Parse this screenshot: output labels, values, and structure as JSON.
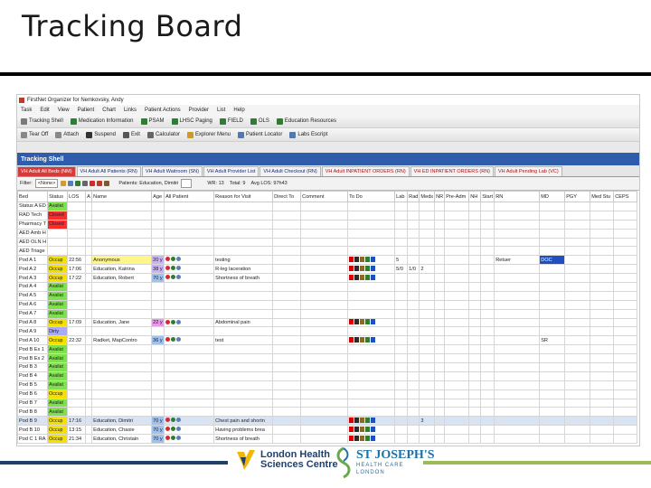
{
  "slide": {
    "title": "Tracking Board"
  },
  "window": {
    "title": "FirstNet Organizer for Nemkovsky, Andy"
  },
  "menu": [
    "Task",
    "Edit",
    "View",
    "Patient",
    "Chart",
    "Links",
    "Patient Actions",
    "Provider",
    "List",
    "Help"
  ],
  "toolbar1": [
    {
      "label": "Tracking Shell",
      "icon": "grid-icon",
      "color": "#7a7a7a"
    },
    {
      "label": "Medication Information",
      "icon": "info-icon",
      "color": "#2e7d32"
    },
    {
      "label": "PSAM",
      "icon": "link-icon",
      "color": "#2e7d32"
    },
    {
      "label": "LHSC Paging",
      "icon": "link-icon",
      "color": "#2e7d32"
    },
    {
      "label": "FIELD",
      "icon": "link-icon",
      "color": "#2e7d32"
    },
    {
      "label": "OLS",
      "icon": "link-icon",
      "color": "#2e7d32"
    },
    {
      "label": "Education Resources",
      "icon": "link-icon",
      "color": "#2e7d32"
    }
  ],
  "toolbar2": [
    {
      "label": "Tear Off",
      "icon": "tearoff-icon",
      "color": "#888888"
    },
    {
      "label": "Attach",
      "icon": "attach-icon",
      "color": "#888888"
    },
    {
      "label": "Suspend",
      "icon": "suspend-icon",
      "color": "#333333"
    },
    {
      "label": "Exit",
      "icon": "exit-icon",
      "color": "#555555"
    },
    {
      "label": "Calculator",
      "icon": "calculator-icon",
      "color": "#666666"
    },
    {
      "label": "Explorer Menu",
      "icon": "explorer-icon",
      "color": "#c99a2e"
    },
    {
      "label": "Patient Locator",
      "icon": "locator-icon",
      "color": "#5577aa"
    },
    {
      "label": "Labs Escript",
      "icon": "labs-icon",
      "color": "#5577aa"
    }
  ],
  "tracking_header": "Tracking Shell",
  "tabs": [
    {
      "label": "VH Adult All Beds (NM)",
      "active": true
    },
    {
      "label": "VH Adult All Patients (RN)",
      "active": false
    },
    {
      "label": "VH Adult Waitroom (SN)",
      "active": false
    },
    {
      "label": "VH Adult Provider List",
      "active": false
    },
    {
      "label": "VH Adult Checkout (RN)",
      "active": false
    },
    {
      "label": "VH Adult INPATIENT ORDERS (RN)",
      "active": false
    },
    {
      "label": "VH ED INPATIENT ORDERS (RN)",
      "active": false
    },
    {
      "label": "VH Adult Pending Lab (VC)",
      "active": false
    }
  ],
  "filter": {
    "filter_label": "Filter:",
    "filter_value": "<None>",
    "patients_label": "Patients: Education, Dimitri",
    "wr_label": "WR: 13",
    "total_label": "Total: 9",
    "avg_label": "Avg LOS: 97h43"
  },
  "columns": [
    "Bed",
    "Status",
    "LOS",
    "A",
    "Name",
    "Age",
    "All Patient",
    "Reason for Visit",
    "Direct To",
    "Comment",
    "To Do",
    "Lab",
    "Rad",
    "Meds",
    "NR",
    "Pre-Adm",
    "NH",
    "Start",
    "RN",
    "MD",
    "PGY",
    "Med Stu",
    "CEPS"
  ],
  "rows": [
    {
      "bed": "Status A ED",
      "status": "Availat",
      "status_color": "#7ee04c",
      "los": "",
      "name": "",
      "age": "",
      "age_color": "",
      "reason": "",
      "todo": "",
      "lab": "",
      "rad": "",
      "meds": "",
      "nr": "",
      "rn": "",
      "md": "",
      "md_color": "",
      "selected": false
    },
    {
      "bed": "RAD Tech",
      "status": "Closed",
      "status_color": "#ff2a2a",
      "los": "",
      "name": "",
      "age": "",
      "age_color": "",
      "reason": "",
      "todo": "",
      "lab": "",
      "rad": "",
      "meds": "",
      "nr": "",
      "rn": "",
      "md": "",
      "md_color": "",
      "selected": false
    },
    {
      "bed": "Pharmacy T",
      "status": "Closed",
      "status_color": "#ff2a2a",
      "los": "",
      "name": "",
      "age": "",
      "age_color": "",
      "reason": "",
      "todo": "",
      "lab": "",
      "rad": "",
      "meds": "",
      "nr": "",
      "rn": "",
      "md": "",
      "md_color": "",
      "selected": false
    },
    {
      "bed": "AED Amb H",
      "status": "",
      "status_color": "",
      "los": "",
      "name": "",
      "age": "",
      "age_color": "",
      "reason": "",
      "todo": "",
      "lab": "",
      "rad": "",
      "meds": "",
      "nr": "",
      "rn": "",
      "md": "",
      "md_color": "",
      "selected": false
    },
    {
      "bed": "AED OLN H",
      "status": "",
      "status_color": "",
      "los": "",
      "name": "",
      "age": "",
      "age_color": "",
      "reason": "",
      "todo": "",
      "lab": "",
      "rad": "",
      "meds": "",
      "nr": "",
      "rn": "",
      "md": "",
      "md_color": "",
      "selected": false
    },
    {
      "bed": "AED Triage",
      "status": "",
      "status_color": "",
      "los": "",
      "name": "",
      "age": "",
      "age_color": "",
      "reason": "",
      "todo": "",
      "lab": "",
      "rad": "",
      "meds": "",
      "nr": "",
      "rn": "",
      "md": "",
      "md_color": "",
      "selected": false
    },
    {
      "bed": "Pod A 1",
      "status": "Occup",
      "status_color": "#f5e000",
      "los": "22:56",
      "name": "Anonymous",
      "name_color": "#fff68a",
      "age": "20 y",
      "age_color": "#c9b3f2",
      "reason": "testing",
      "todo": "icons",
      "lab": "5",
      "rad": "",
      "meds": "",
      "nr": "",
      "rn": "Retuer",
      "md": "DOC",
      "md_color": "#1f4fc0",
      "selected": false
    },
    {
      "bed": "Pod A 2",
      "status": "Occup",
      "status_color": "#f5e000",
      "los": "17:06",
      "name": "Education, Katrina",
      "age": "38 y",
      "age_color": "#c9b3f2",
      "reason": "R-leg laceration",
      "todo": "icons",
      "lab": "5/0",
      "rad": "1/0",
      "meds": "2",
      "nr": "",
      "rn": "",
      "md": "",
      "md_color": "",
      "selected": false
    },
    {
      "bed": "Pod A 3",
      "status": "Occup",
      "status_color": "#f5e000",
      "los": "17:22",
      "name": "Education, Robert",
      "age": "70 y",
      "age_color": "#9fc1f0",
      "reason": "Shortness of breath",
      "todo": "icons",
      "lab": "",
      "rad": "",
      "meds": "",
      "nr": "",
      "rn": "",
      "md": "",
      "md_color": "",
      "selected": false
    },
    {
      "bed": "Pod A 4",
      "status": "Availat",
      "status_color": "#7ee04c",
      "los": "",
      "name": "",
      "age": "",
      "age_color": "",
      "reason": "",
      "todo": "",
      "lab": "",
      "rad": "",
      "meds": "",
      "nr": "",
      "rn": "",
      "md": "",
      "md_color": "",
      "selected": false
    },
    {
      "bed": "Pod A 5",
      "status": "Availat",
      "status_color": "#7ee04c",
      "los": "",
      "name": "",
      "age": "",
      "age_color": "",
      "reason": "",
      "todo": "",
      "lab": "",
      "rad": "",
      "meds": "",
      "nr": "",
      "rn": "",
      "md": "",
      "md_color": "",
      "selected": false
    },
    {
      "bed": "Pod A 6",
      "status": "Availat",
      "status_color": "#7ee04c",
      "los": "",
      "name": "",
      "age": "",
      "age_color": "",
      "reason": "",
      "todo": "",
      "lab": "",
      "rad": "",
      "meds": "",
      "nr": "",
      "rn": "",
      "md": "",
      "md_color": "",
      "selected": false
    },
    {
      "bed": "Pod A 7",
      "status": "Availat",
      "status_color": "#7ee04c",
      "los": "",
      "name": "",
      "age": "",
      "age_color": "",
      "reason": "",
      "todo": "",
      "lab": "",
      "rad": "",
      "meds": "",
      "nr": "",
      "rn": "",
      "md": "",
      "md_color": "",
      "selected": false
    },
    {
      "bed": "Pod A 8",
      "status": "Occup",
      "status_color": "#f5e000",
      "los": "17:09",
      "name": "Education, Jane",
      "age": "22 y",
      "age_color": "#e89ae8",
      "reason": "Abdominal pain",
      "todo": "icons",
      "lab": "",
      "rad": "",
      "meds": "",
      "nr": "",
      "rn": "",
      "md": "",
      "md_color": "",
      "selected": false
    },
    {
      "bed": "Pod A 9",
      "status": "Dirty",
      "status_color": "#a9a9f5",
      "los": "",
      "name": "",
      "age": "",
      "age_color": "",
      "reason": "",
      "todo": "",
      "lab": "",
      "rad": "",
      "meds": "",
      "nr": "",
      "rn": "",
      "md": "",
      "md_color": "",
      "selected": false
    },
    {
      "bed": "Pod A 10",
      "status": "Occup",
      "status_color": "#f5e000",
      "los": "22:32",
      "name": "Radket, MapContro",
      "age": "36 y",
      "age_color": "#9fc1f0",
      "reason": "test",
      "todo": "icons",
      "lab": "",
      "rad": "",
      "meds": "",
      "nr": "",
      "rn": "",
      "md": "SR",
      "md_color": "",
      "selected": false
    },
    {
      "bed": "Pod B Ex 1",
      "status": "Availat",
      "status_color": "#7ee04c",
      "los": "",
      "name": "",
      "age": "",
      "age_color": "",
      "reason": "",
      "todo": "",
      "lab": "",
      "rad": "",
      "meds": "",
      "nr": "",
      "rn": "",
      "md": "",
      "md_color": "",
      "selected": false
    },
    {
      "bed": "Pod B Ex 2",
      "status": "Availat",
      "status_color": "#7ee04c",
      "los": "",
      "name": "",
      "age": "",
      "age_color": "",
      "reason": "",
      "todo": "",
      "lab": "",
      "rad": "",
      "meds": "",
      "nr": "",
      "rn": "",
      "md": "",
      "md_color": "",
      "selected": false
    },
    {
      "bed": "Pod B 3",
      "status": "Availat",
      "status_color": "#7ee04c",
      "los": "",
      "name": "",
      "age": "",
      "age_color": "",
      "reason": "",
      "todo": "",
      "lab": "",
      "rad": "",
      "meds": "",
      "nr": "",
      "rn": "",
      "md": "",
      "md_color": "",
      "selected": false
    },
    {
      "bed": "Pod B 4",
      "status": "Availat",
      "status_color": "#7ee04c",
      "los": "",
      "name": "",
      "age": "",
      "age_color": "",
      "reason": "",
      "todo": "",
      "lab": "",
      "rad": "",
      "meds": "",
      "nr": "",
      "rn": "",
      "md": "",
      "md_color": "",
      "selected": false
    },
    {
      "bed": "Pod B 5",
      "status": "Availat",
      "status_color": "#7ee04c",
      "los": "",
      "name": "",
      "age": "",
      "age_color": "",
      "reason": "",
      "todo": "",
      "lab": "",
      "rad": "",
      "meds": "",
      "nr": "",
      "rn": "",
      "md": "",
      "md_color": "",
      "selected": false
    },
    {
      "bed": "Pod B 6",
      "status": "Occup",
      "status_color": "#f5e000",
      "los": "",
      "name": "",
      "age": "",
      "age_color": "",
      "reason": "",
      "todo": "",
      "lab": "",
      "rad": "",
      "meds": "",
      "nr": "",
      "rn": "",
      "md": "",
      "md_color": "",
      "selected": false
    },
    {
      "bed": "Pod B 7",
      "status": "Availat",
      "status_color": "#7ee04c",
      "los": "",
      "name": "",
      "age": "",
      "age_color": "",
      "reason": "",
      "todo": "",
      "lab": "",
      "rad": "",
      "meds": "",
      "nr": "",
      "rn": "",
      "md": "",
      "md_color": "",
      "selected": false
    },
    {
      "bed": "Pod B 8",
      "status": "Availat",
      "status_color": "#7ee04c",
      "los": "",
      "name": "",
      "age": "",
      "age_color": "",
      "reason": "",
      "todo": "",
      "lab": "",
      "rad": "",
      "meds": "",
      "nr": "",
      "rn": "",
      "md": "",
      "md_color": "",
      "selected": false
    },
    {
      "bed": "Pod B 9",
      "status": "Occup",
      "status_color": "#f5e000",
      "los": "17:16",
      "name": "Education, Dimitri",
      "age": "70 y",
      "age_color": "#9fc1f0",
      "reason": "Chest pain and shortn",
      "todo": "icons",
      "lab": "",
      "rad": "",
      "meds": "3",
      "nr": "",
      "rn": "",
      "md": "",
      "md_color": "",
      "selected": true
    },
    {
      "bed": "Pod B 10",
      "status": "Occup",
      "status_color": "#f5e000",
      "los": "13:15",
      "name": "Education, Chasie",
      "age": "70 y",
      "age_color": "#9fc1f0",
      "reason": "Having problems brea",
      "todo": "icons",
      "lab": "",
      "rad": "",
      "meds": "",
      "nr": "",
      "rn": "",
      "md": "",
      "md_color": "",
      "selected": false
    },
    {
      "bed": "Pod C 1 RA",
      "status": "Occup",
      "status_color": "#f5e000",
      "los": "21:34",
      "name": "Education, Christain",
      "age": "70 y",
      "age_color": "#9fc1f0",
      "reason": "Shortness of breath",
      "todo": "icons",
      "lab": "",
      "rad": "",
      "meds": "",
      "nr": "",
      "rn": "",
      "md": "",
      "md_color": "",
      "selected": false
    }
  ],
  "logos": {
    "lhsc_line1": "London Health",
    "lhsc_line2": "Sciences Centre",
    "sjh_line1": "ST JOSEPH'S",
    "sjh_line2": "HEALTH CARE",
    "sjh_line3": "LONDON"
  }
}
